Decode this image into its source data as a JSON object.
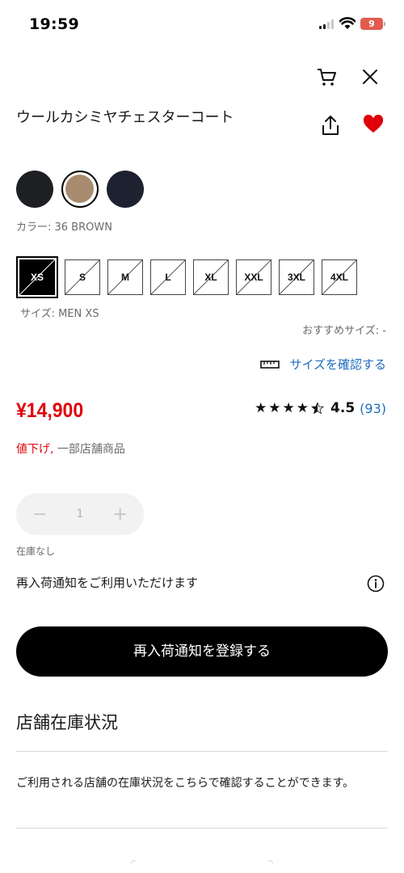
{
  "status_bar": {
    "time": "19:59",
    "battery": "9"
  },
  "product": {
    "title": "ウールカシミヤチェスターコート"
  },
  "colors": {
    "swatches": [
      {
        "name": "black",
        "hex": "#1d1f22"
      },
      {
        "name": "brown",
        "hex": "#a88b6e",
        "selected": true
      },
      {
        "name": "navy",
        "hex": "#1e2230"
      }
    ],
    "label": "カラー: 36 BROWN"
  },
  "sizes": {
    "options": [
      "XS",
      "S",
      "M",
      "L",
      "XL",
      "XXL",
      "3XL",
      "4XL"
    ],
    "selected": "XS",
    "label": "サイズ: MEN XS",
    "recommended": "おすすめサイズ: -",
    "check_link": "サイズを確認する"
  },
  "pricing": {
    "price": "¥14,900",
    "rating": "4.5",
    "rating_count": "(93)",
    "stars": "★★★★",
    "promo_red": "値下げ,",
    "promo_gray": " 一部店舗商品"
  },
  "quantity": {
    "minus": "−",
    "value": "1",
    "plus": "+",
    "stock_label": "在庫なし"
  },
  "restock": {
    "text": "再入荷通知をご利用いただけます",
    "button": "再入荷通知を登録する"
  },
  "store": {
    "heading": "店舗在庫状況",
    "description": "ご利用される店舗の在庫状況をこちらで確認することができます。"
  },
  "theme": {
    "accent_red": "#e0000b",
    "link_blue": "#1f6dbd"
  }
}
